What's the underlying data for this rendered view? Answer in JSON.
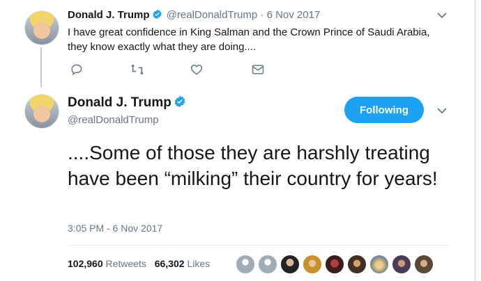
{
  "parent_tweet": {
    "name": "Donald J. Trump",
    "handle": "@realDonaldTrump",
    "date": "· 6 Nov 2017",
    "text": "I have great confidence in King Salman and the Crown Prince of Saudi Arabia, they know exactly what they are doing...."
  },
  "main_tweet": {
    "name": "Donald J. Trump",
    "handle": "@realDonaldTrump",
    "follow_label": "Following",
    "text": "....Some of those they are harshly treating have been “milking” their country for years!",
    "timestamp": "3:05 PM - 6 Nov 2017",
    "retweets_count": "102,960",
    "retweets_label": "Retweets",
    "likes_count": "66,302",
    "likes_label": "Likes"
  },
  "colors": {
    "accent": "#1da1f2",
    "muted": "#657786",
    "text": "#14171a"
  },
  "icons": [
    "reply-icon",
    "retweet-icon",
    "like-icon",
    "message-icon",
    "chevron-down-icon",
    "verified-badge-icon"
  ]
}
